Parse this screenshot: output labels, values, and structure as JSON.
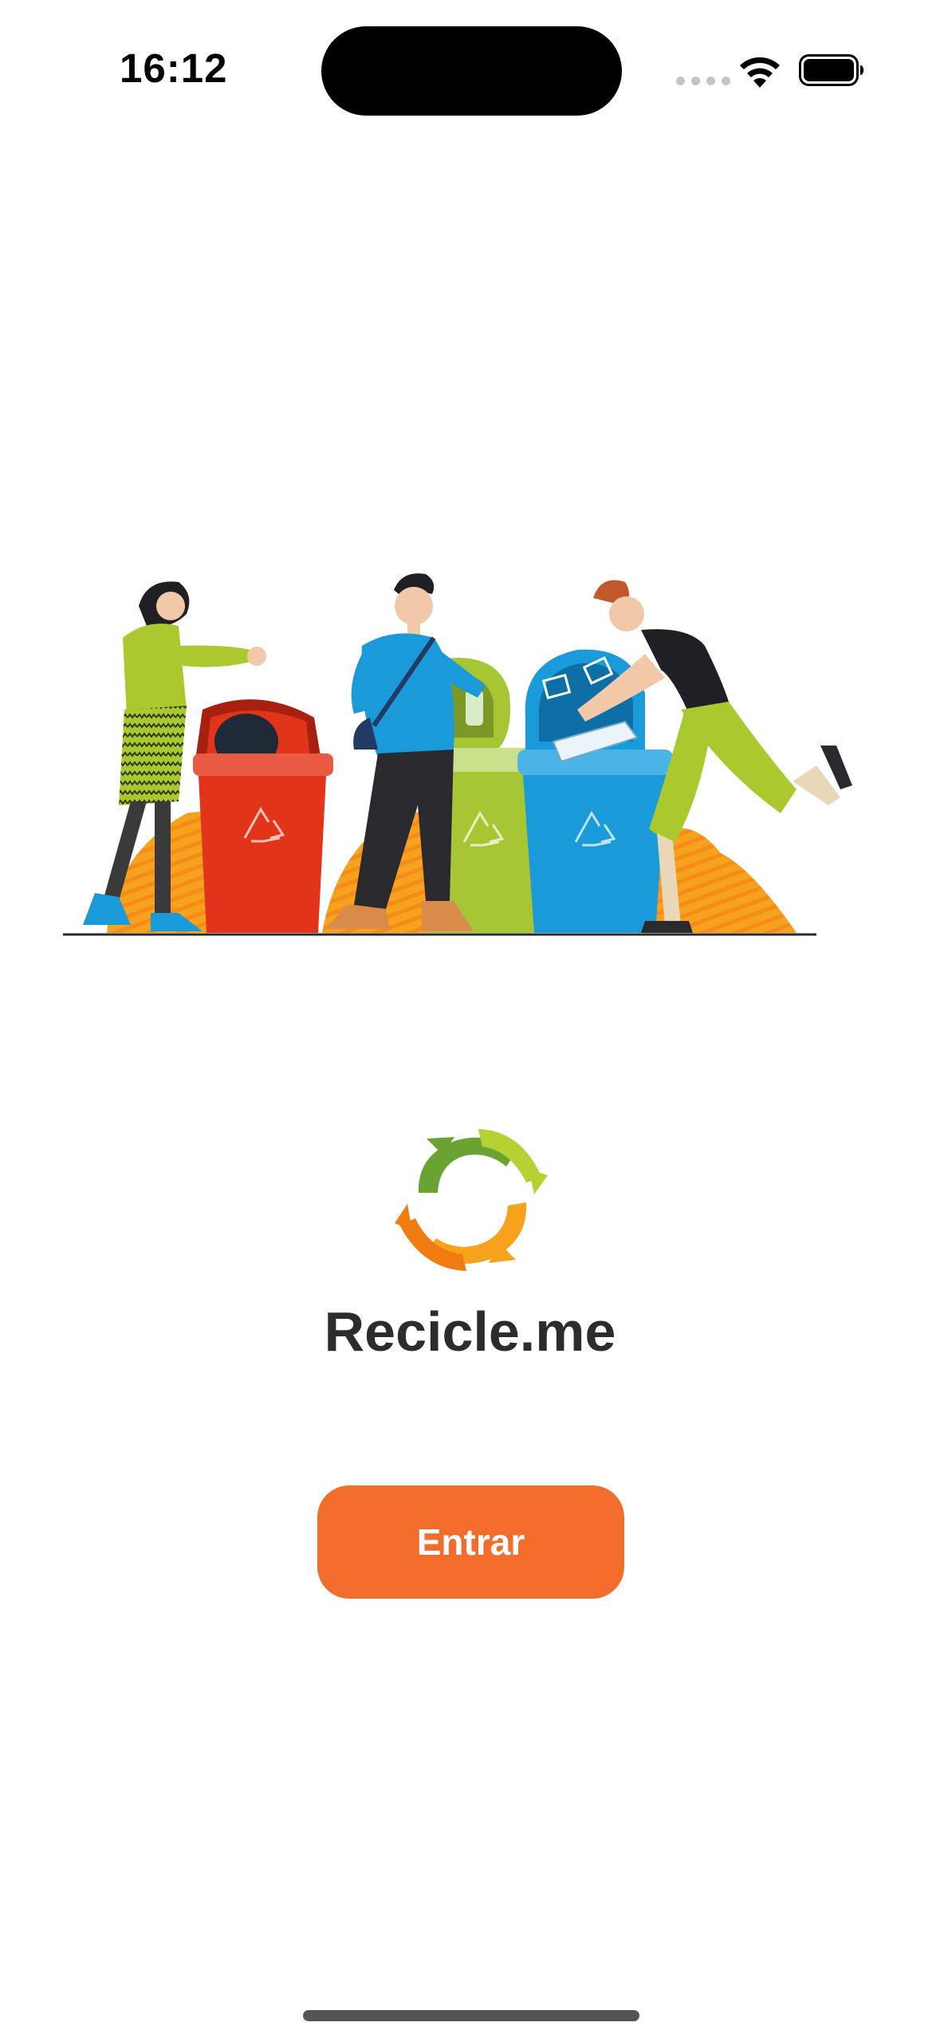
{
  "status_bar": {
    "time": "16:12"
  },
  "brand": {
    "app_name": "Recicle.me"
  },
  "actions": {
    "enter_label": "Entrar"
  },
  "colors": {
    "accent": "#f26d2b",
    "title_text": "#2c2c2c",
    "bin_red": "#e2341b",
    "bin_green": "#a7c633",
    "bin_blue": "#1a9ad8",
    "ground_orange": "#f7a21c"
  },
  "icons": {
    "wifi": "wifi-icon",
    "battery": "battery-icon",
    "logo": "recycle-arrows-icon",
    "recycle": "recycle-symbol-icon"
  }
}
